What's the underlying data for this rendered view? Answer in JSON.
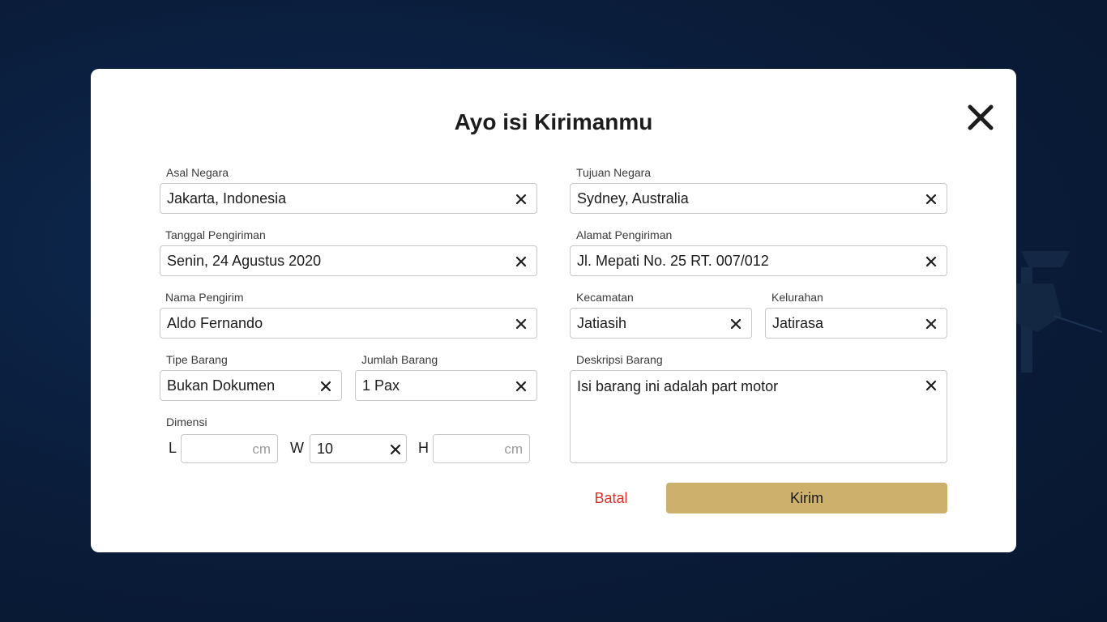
{
  "modal": {
    "title": "Ayo isi Kirimanmu"
  },
  "form": {
    "asal_negara": {
      "label": "Asal Negara",
      "value": "Jakarta, Indonesia"
    },
    "tujuan_negara": {
      "label": "Tujuan Negara",
      "value": "Sydney, Australia"
    },
    "tanggal_pengiriman": {
      "label": "Tanggal Pengiriman",
      "value": "Senin, 24 Agustus 2020"
    },
    "alamat_pengiriman": {
      "label": "Alamat Pengiriman",
      "value": "Jl. Mepati No. 25 RT. 007/012"
    },
    "nama_pengirim": {
      "label": "Nama Pengirim",
      "value": "Aldo Fernando"
    },
    "kecamatan": {
      "label": "Kecamatan",
      "value": "Jatiasih"
    },
    "kelurahan": {
      "label": "Kelurahan",
      "value": "Jatirasa"
    },
    "tipe_barang": {
      "label": "Tipe Barang",
      "value": "Bukan Dokumen"
    },
    "jumlah_barang": {
      "label": "Jumlah Barang",
      "value": "1 Pax"
    },
    "deskripsi_barang": {
      "label": "Deskripsi Barang",
      "value": "Isi barang ini adalah part motor"
    },
    "dimensi": {
      "label": "Dimensi",
      "l": {
        "letter": "L",
        "value": "",
        "unit": "cm"
      },
      "w": {
        "letter": "W",
        "value": "10"
      },
      "h": {
        "letter": "H",
        "value": "",
        "unit": "cm"
      }
    }
  },
  "actions": {
    "cancel_label": "Batal",
    "submit_label": "Kirim"
  },
  "colors": {
    "background": "#0b1f3f",
    "accent_gold": "#cdb06c",
    "cancel_red": "#e0302a"
  }
}
